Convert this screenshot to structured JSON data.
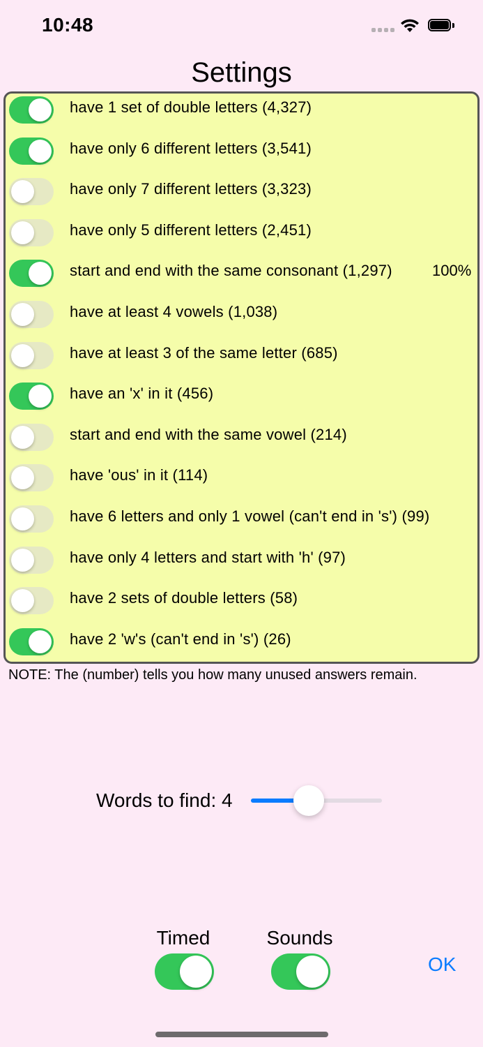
{
  "status": {
    "time": "10:48"
  },
  "title": "Settings",
  "rules": [
    {
      "label": "have 1 set of double letters (4,327)",
      "on": true,
      "percent": ""
    },
    {
      "label": "have only 6 different letters (3,541)",
      "on": true,
      "percent": ""
    },
    {
      "label": "have only 7 different letters (3,323)",
      "on": false,
      "percent": ""
    },
    {
      "label": "have only 5 different letters (2,451)",
      "on": false,
      "percent": ""
    },
    {
      "label": "start and end with the same consonant (1,297)",
      "on": true,
      "percent": "100%"
    },
    {
      "label": "have at least 4 vowels (1,038)",
      "on": false,
      "percent": ""
    },
    {
      "label": "have at least 3 of the same letter (685)",
      "on": false,
      "percent": ""
    },
    {
      "label": "have an 'x' in it (456)",
      "on": true,
      "percent": ""
    },
    {
      "label": "start and end with the same vowel (214)",
      "on": false,
      "percent": ""
    },
    {
      "label": "have 'ous' in it (114)",
      "on": false,
      "percent": ""
    },
    {
      "label": "have 6 letters and only 1 vowel (can't end in 's') (99)",
      "on": false,
      "percent": ""
    },
    {
      "label": "have only 4 letters and start with 'h' (97)",
      "on": false,
      "percent": ""
    },
    {
      "label": "have 2 sets of double letters (58)",
      "on": false,
      "percent": ""
    },
    {
      "label": "have 2 'w's (can't end in 's') (26)",
      "on": true,
      "percent": ""
    }
  ],
  "note": "NOTE: The (number) tells you how many unused answers remain.",
  "words_to_find": {
    "label": "Words to find: 4",
    "level": 0.375
  },
  "options": {
    "timed": {
      "label": "Timed",
      "on": true
    },
    "sounds": {
      "label": "Sounds",
      "on": true
    }
  },
  "ok_label": "OK",
  "colors": {
    "accent": "#0a7cff",
    "toggle_on": "#34c759",
    "panel": "#f5fdaa",
    "background": "#fdeaf6"
  }
}
